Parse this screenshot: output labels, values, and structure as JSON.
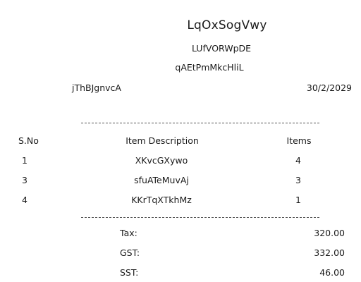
{
  "receipt": {
    "store_name": "LqOxSogVwy",
    "address_line1": "LUfVORWpDE",
    "address_line2": "qAEtPmMkcHliL",
    "customer": "jThBJgnvcA",
    "date": "30/2/2029",
    "columns": {
      "sno": "S.No",
      "description": "Item Description",
      "items": "Items"
    },
    "rows": [
      {
        "sno": "1",
        "description": "XKvcGXywo",
        "items": "4"
      },
      {
        "sno": "3",
        "description": "sfuATeMuvAj",
        "items": "3"
      },
      {
        "sno": "4",
        "description": "KKrTqXTkhMz",
        "items": "1"
      }
    ],
    "totals": [
      {
        "label": "Tax:",
        "value": "320.00"
      },
      {
        "label": "GST:",
        "value": "332.00"
      },
      {
        "label": "SST:",
        "value": "46.00"
      }
    ]
  }
}
